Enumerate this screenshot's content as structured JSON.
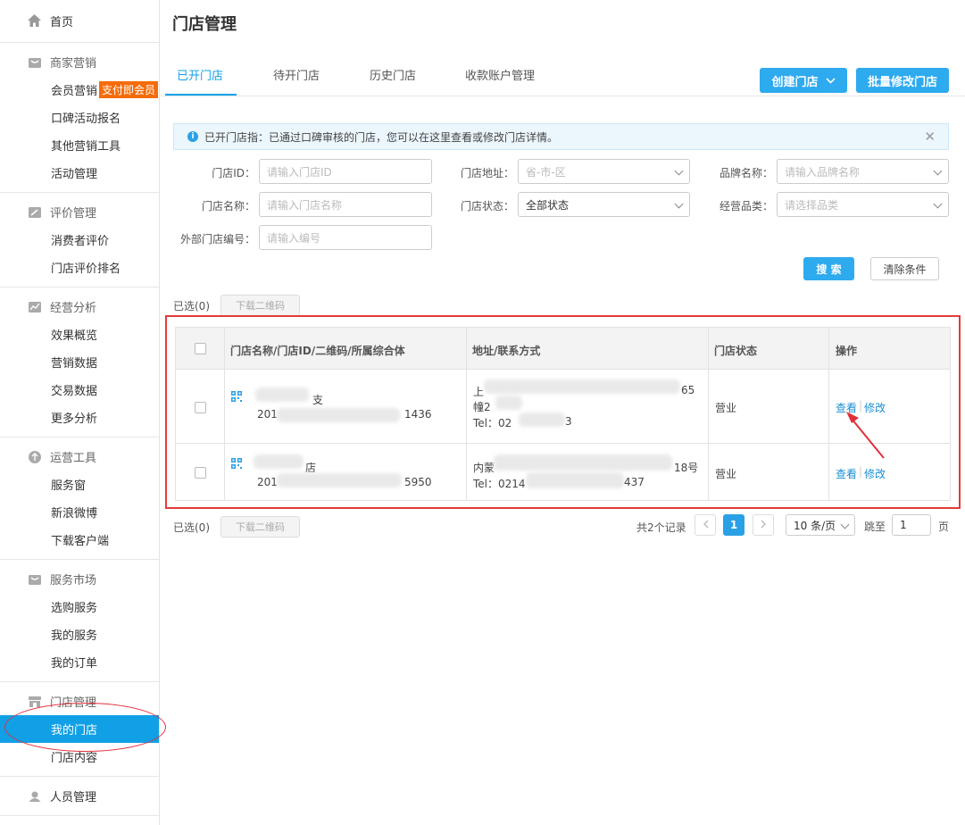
{
  "sidebar": {
    "home": "首页",
    "groups": [
      {
        "title": "商家营销",
        "items": [
          "会员营销",
          "口碑活动报名",
          "其他营销工具",
          "活动管理"
        ],
        "badge": "支付即会员"
      },
      {
        "title": "评价管理",
        "items": [
          "消费者评价",
          "门店评价排名"
        ]
      },
      {
        "title": "经营分析",
        "items": [
          "效果概览",
          "营销数据",
          "交易数据",
          "更多分析"
        ]
      },
      {
        "title": "运营工具",
        "items": [
          "服务窗",
          "新浪微博",
          "下载客户端"
        ]
      },
      {
        "title": "服务市场",
        "items": [
          "选购服务",
          "我的服务",
          "我的订单"
        ]
      },
      {
        "title": "门店管理",
        "items": [
          "我的门店",
          "门店内容"
        ]
      },
      {
        "title": "人员管理",
        "items": []
      }
    ]
  },
  "page": {
    "title": "门店管理"
  },
  "tabs": [
    "已开门店",
    "待开门店",
    "历史门店",
    "收款账户管理"
  ],
  "actions": {
    "create": "创建门店",
    "batch": "批量修改门店"
  },
  "notice": "已开门店指：已通过口碑审核的门店，您可以在这里查看或修改门店详情。",
  "filters": {
    "store_id": {
      "label": "门店ID：",
      "placeholder": "请输入门店ID"
    },
    "store_name": {
      "label": "门店名称：",
      "placeholder": "请输入门店名称"
    },
    "ext_no": {
      "label": "外部门店编号：",
      "placeholder": "请输入编号"
    },
    "address": {
      "label": "门店地址：",
      "placeholder": "省-市-区"
    },
    "status": {
      "label": "门店状态：",
      "value": "全部状态"
    },
    "brand": {
      "label": "品牌名称：",
      "placeholder": "请输入品牌名称"
    },
    "category": {
      "label": "经营品类：",
      "placeholder": "请选择品类"
    },
    "search": "搜 索",
    "clear": "清除条件"
  },
  "selection": {
    "label": "已选(0)",
    "download": "下载二维码"
  },
  "table": {
    "columns": [
      "门店名称/门店ID/二维码/所属综合体",
      "地址/联系方式",
      "门店状态",
      "操作"
    ],
    "rows": [
      {
        "name": "支",
        "id_prefix": "201",
        "id_suffix": "1436",
        "addr1": "上",
        "addr1_end": "65",
        "addr2": "幢2",
        "phone": "Tel：02",
        "phone_end": "3",
        "status": "营业",
        "view": "查看",
        "edit": "修改"
      },
      {
        "name": "店",
        "id_prefix": "201",
        "id_suffix": "5950",
        "addr1": "内蒙",
        "addr1_end": "18号",
        "phone": "Tel：0214",
        "phone_end": "437",
        "status": "营业",
        "view": "查看",
        "edit": "修改"
      }
    ]
  },
  "pagination": {
    "total": "共2个记录",
    "current": "1",
    "page_size": "10 条/页",
    "jump_label": "跳至",
    "jump_value": "1",
    "page_unit": "页"
  }
}
